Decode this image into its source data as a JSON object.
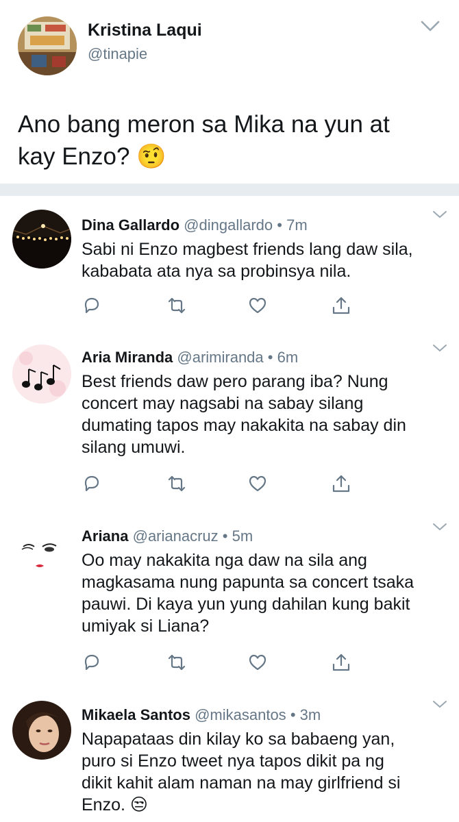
{
  "main_tweet": {
    "name": "Kristina Laqui",
    "handle": "@tinapie",
    "text_line1": "Ano bang meron sa Mika na yun at",
    "text_line2": "kay Enzo?",
    "emoji": "🤨",
    "avatar_icon": "classroom-photo-avatar"
  },
  "replies": [
    {
      "name": "Dina Gallardo",
      "handle": "@dingallardo",
      "time": "• 7m",
      "lines": [
        "Sabi ni Enzo magbest friends lang daw sila,",
        "kababata ata nya sa probinsya nila."
      ],
      "avatar_icon": "night-lights-avatar"
    },
    {
      "name": "Aria Miranda",
      "handle": "@arimiranda",
      "time": "• 6m",
      "lines": [
        "Best friends daw pero parang iba? Nung",
        "concert may nagsabi na sabay silang",
        "dumating tapos may nakakita na sabay din",
        "silang umuwi."
      ],
      "avatar_icon": "music-notes-avatar"
    },
    {
      "name": "Ariana",
      "handle": "@arianacruz",
      "time": "• 5m",
      "lines": [
        "Oo may nakakita nga daw na sila ang",
        "magkasama nung papunta sa concert tsaka",
        "pauwi. Di kaya yun yung dahilan kung bakit",
        "umiyak si Liana?"
      ],
      "avatar_icon": "face-drawing-avatar"
    },
    {
      "name": "Mikaela Santos",
      "handle": "@mikasantos",
      "time": "• 3m",
      "lines": [
        "Napapataas din kilay ko sa babaeng yan,",
        "puro si Enzo tweet nya tapos dikit pa ng",
        "dikit kahit alam naman na may girlfriend si",
        "Enzo."
      ],
      "emoji": "😒",
      "avatar_icon": "woman-portrait-avatar"
    }
  ],
  "icons": {
    "reply": "reply-icon",
    "retweet": "retweet-icon",
    "like": "like-icon",
    "share": "share-icon",
    "chevron": "chevron-down-icon"
  },
  "colors": {
    "icon_gray": "#657786",
    "divider": "#e6ecf0"
  }
}
